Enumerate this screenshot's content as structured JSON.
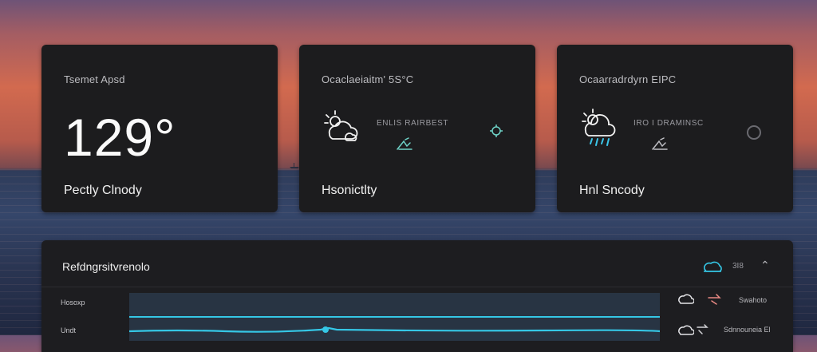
{
  "cards": [
    {
      "title": "Tsemet Apsd",
      "temperature": "129°",
      "condition": "Pectly Clnody"
    },
    {
      "title": "Ocaclaeiaitm' 5S°C",
      "detail": "ENLIS RAIRBEST",
      "condition": "Hsonictlty"
    },
    {
      "title": "Ocaarradrdyrn EIPC",
      "detail": "IRO I DRAMINSC",
      "condition": "Hnl Sncody"
    }
  ],
  "panel": {
    "title": "Refdngrsitvrenolo",
    "header_value": "3I8",
    "row_labels": [
      "Hosoxp",
      "Undt"
    ],
    "side_items": [
      "Swahoto",
      "Sdnnouneia El"
    ]
  },
  "colors": {
    "accent_cyan": "#35c7e6",
    "card_bg": "#1c1c1e",
    "panel_bg": "#1d1d20"
  },
  "icons": [
    "partly-cloudy-icon",
    "cloud-rain-icon",
    "wind-icon",
    "sun-cloud-icon",
    "settings-icon",
    "chevron-up-icon"
  ]
}
